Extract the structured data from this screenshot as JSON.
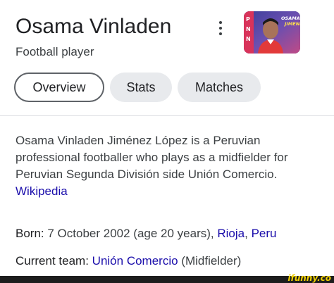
{
  "header": {
    "title": "Osama Vinladen",
    "subtitle": "Football player",
    "thumbnail_caption_line1": "OSAMA VINLA",
    "thumbnail_caption_line2": "JIMENEZ"
  },
  "tabs": [
    {
      "label": "Overview",
      "active": true
    },
    {
      "label": "Stats",
      "active": false
    },
    {
      "label": "Matches",
      "active": false
    }
  ],
  "description": {
    "lines": [
      "Osama Vinladen Jiménez López is a Peruvian",
      "professional footballer who plays as a midfielder for",
      "Peruvian Segunda División side Unión Comercio."
    ],
    "source_link": "Wikipedia"
  },
  "facts": {
    "born": {
      "label": "Born:",
      "value": "7 October 2002 (age 20 years),",
      "place_city": "Rioja",
      "separator": ",",
      "place_country": "Peru"
    },
    "current_team": {
      "label": "Current team:",
      "team": "Unión Comercio",
      "role": "(Midfielder)"
    }
  },
  "watermark": "ifunny.co",
  "colors": {
    "link": "#1a0dab",
    "text": "#202124",
    "chip_bg": "#e8eaed",
    "chip_border_active": "#5f6368",
    "divider": "#dadce0",
    "watermark": "#f0d000"
  },
  "icons": {
    "more_options": "three-dots-vertical-icon"
  }
}
